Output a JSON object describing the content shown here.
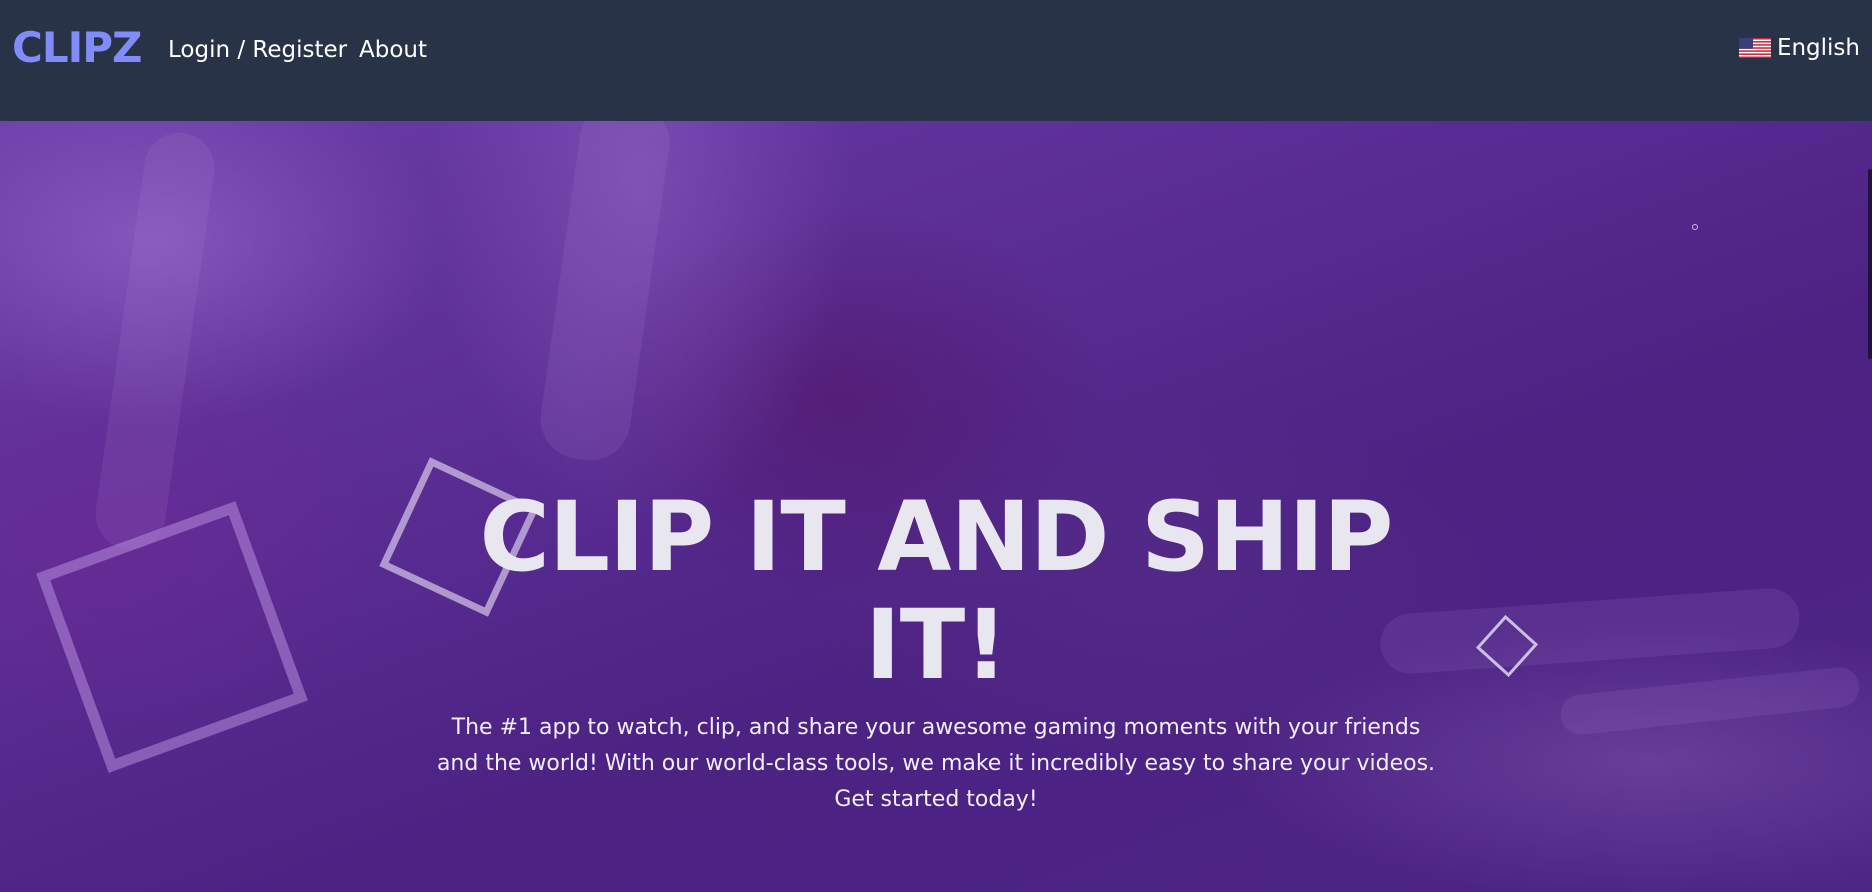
{
  "navbar": {
    "brand": "CLIPZ",
    "links": [
      {
        "label": "Login / Register"
      },
      {
        "label": "About"
      }
    ],
    "language": {
      "label": "English",
      "flag_icon": "us-flag-icon"
    }
  },
  "hero": {
    "title": "CLIP IT AND SHIP IT!",
    "description": "The #1 app to watch, clip, and share your awesome gaming moments with your friends and the world! With our world-class tools, we make it incredibly easy to share your videos. Get started today!"
  },
  "colors": {
    "navbar_background": "#283347",
    "brand": "#818cf8",
    "hero_background": "#5a2d93",
    "hero_title": "#e8e6ef"
  }
}
